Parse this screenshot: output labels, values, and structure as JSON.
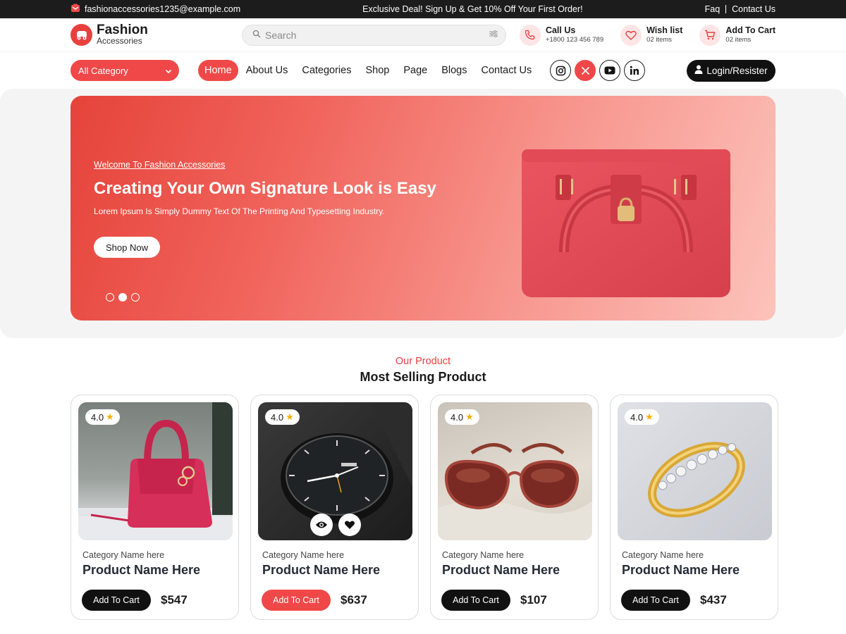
{
  "topbar": {
    "email": "fashionaccessories1235@example.com",
    "promo": "Exclusive Deal! Sign Up & Get 10% Off Your First Order!",
    "links": [
      "Faq",
      "Contact Us"
    ]
  },
  "header": {
    "logo_line1": "Fashion",
    "logo_line2": "Accessories",
    "search_placeholder": "Search",
    "call": {
      "title": "Call Us",
      "sub": "+1800 123 456 789"
    },
    "wishlist": {
      "title": "Wish list",
      "sub": "02 items"
    },
    "cart": {
      "title": "Add To Cart",
      "sub": "02 items"
    }
  },
  "nav": {
    "category_select": "All Category",
    "items": [
      "Home",
      "About Us",
      "Categories",
      "Shop",
      "Page",
      "Blogs",
      "Contact Us"
    ],
    "active": "Home",
    "socials": [
      "instagram-icon",
      "x-icon",
      "youtube-icon",
      "linkedin-icon"
    ],
    "login_label": "Login/Resister"
  },
  "hero": {
    "kicker": "Welcome To Fashion Accessories",
    "headline": "Creating Your Own Signature Look is Easy",
    "sub": "Lorem Ipsum Is Simply Dummy Text Of The Printing And Typesetting Industry.",
    "cta": "Shop Now",
    "slides": 3,
    "active_slide": 2
  },
  "products_section": {
    "eyebrow": "Our Product",
    "title": "Most Selling Product",
    "items": [
      {
        "rating": "4.0",
        "category": "Category Name here",
        "name": "Product Name Here",
        "cta": "Add To Cart",
        "price": "$547",
        "image": "red-handbag"
      },
      {
        "rating": "4.0",
        "category": "Category Name here",
        "name": "Product Name Here",
        "cta": "Add To Cart",
        "price": "$637",
        "image": "wristwatch"
      },
      {
        "rating": "4.0",
        "category": "Category Name here",
        "name": "Product Name Here",
        "cta": "Add To Cart",
        "price": "$107",
        "image": "sunglasses"
      },
      {
        "rating": "4.0",
        "category": "Category Name here",
        "name": "Product Name Here",
        "cta": "Add To Cart",
        "price": "$437",
        "image": "diamond-ring"
      }
    ]
  },
  "colors": {
    "accent": "#f04848",
    "dark": "#111111",
    "hero_from": "#e5433a",
    "hero_to": "#fcc3bb"
  }
}
